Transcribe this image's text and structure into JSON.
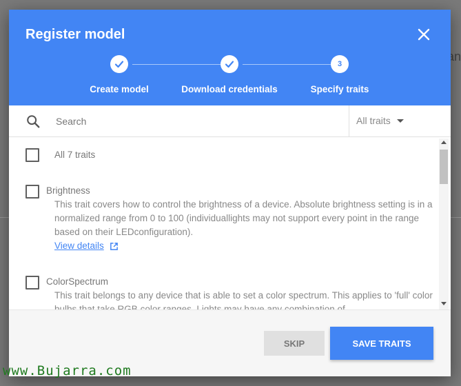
{
  "background": {
    "partial_text": "an"
  },
  "dialog": {
    "title": "Register model",
    "close_icon": "close-icon",
    "steps": [
      {
        "label": "Create model",
        "state": "completed",
        "icon": "check-icon"
      },
      {
        "label": "Download credentials",
        "state": "completed",
        "icon": "check-icon"
      },
      {
        "label": "Specify traits",
        "state": "current",
        "number": "3"
      }
    ],
    "search": {
      "placeholder": "Search",
      "value": "",
      "icon": "search-icon"
    },
    "filter": {
      "selected": "All traits"
    },
    "traits": {
      "all_label": "All 7 traits",
      "items": [
        {
          "name": "Brightness",
          "description": "This trait covers how to control the brightness of a device. Absolute brightness setting is in a normalized range from 0 to 100 (individuallights may not support every point in the range based on their LEDconfiguration).",
          "link": "View details"
        },
        {
          "name": "ColorSpectrum",
          "description": "This trait belongs to any device that is able to set a color spectrum. This applies to 'full' color bulbs that take RGB color ranges. Lights may have any combination of"
        }
      ]
    },
    "buttons": {
      "skip": "SKIP",
      "save": "SAVE TRAITS"
    }
  },
  "watermark": "www.Bujarra.com",
  "colors": {
    "primary": "#4285f4",
    "header_text": "#ffffff",
    "watermark": "#1f7a1f"
  }
}
